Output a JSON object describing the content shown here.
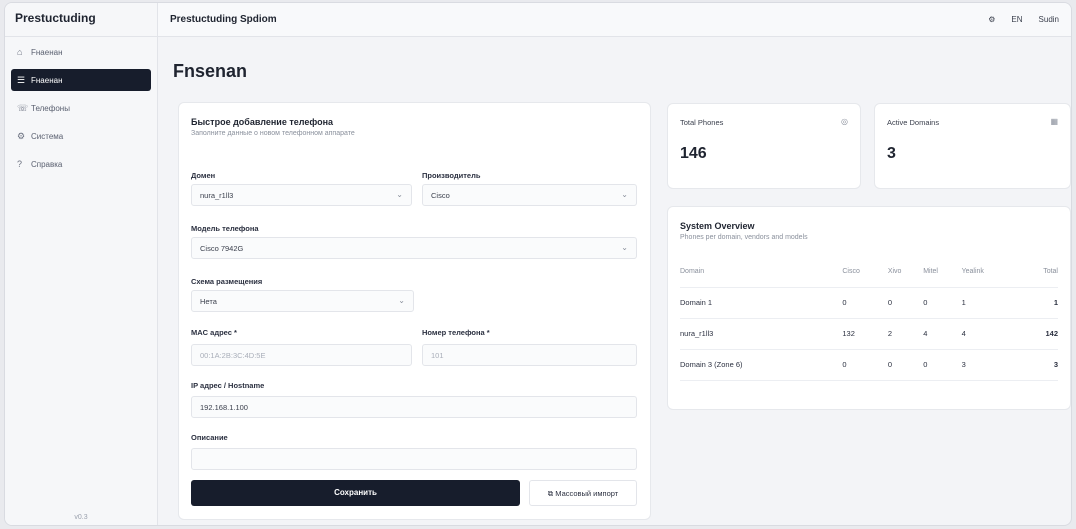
{
  "sidebar": {
    "brand": "Prestuctuding",
    "items": [
      {
        "icon": "home-icon",
        "glyph": "⌂",
        "label": "Fнаенан"
      },
      {
        "icon": "list-icon",
        "glyph": "☰",
        "label": "Fнаенан"
      },
      {
        "icon": "phone-icon",
        "glyph": "☏",
        "label": "Телефоны"
      },
      {
        "icon": "settings-icon",
        "glyph": "⚙",
        "label": "Система"
      },
      {
        "icon": "help-icon",
        "glyph": "?",
        "label": "Справка"
      }
    ],
    "footer": "v0.3"
  },
  "topbar": {
    "title": "Prestuctuding Spdiom",
    "lang": "EN",
    "user": "Sudin"
  },
  "page": {
    "title": "Fnsenan"
  },
  "form": {
    "title": "Быстрое добавление телефона",
    "subtitle": "Заполните данные о новом телефонном аппарате",
    "fields": {
      "domain_label": "Домен",
      "domain_value": "nura_r1ll3",
      "vendor_label": "Производитель",
      "vendor_value": "Cisco",
      "model_label": "Модель телефона",
      "model_value": "Cisco 7942G",
      "schema_label": "Схема размещения",
      "schema_value": "Нета",
      "mac_label": "MAC адрес *",
      "mac_placeholder": "00:1A:2B:3C:4D:5E",
      "number_label": "Номер телефона *",
      "number_placeholder": "101",
      "ip_label": "IP адрес / Hostname",
      "ip_value": "192.168.1.100",
      "desc_label": "Описание",
      "desc_value": ""
    },
    "save_label": "Сохранить",
    "secondary_label": "Массовый импорт"
  },
  "stats": [
    {
      "label": "Total Phones",
      "value": "146",
      "icon": "phone-icon"
    },
    {
      "label": "Active Domains",
      "value": "3",
      "icon": "grid-icon"
    }
  ],
  "systems": {
    "title": "System Overview",
    "subtitle": "Phones per domain, vendors and models",
    "columns": [
      "Domain",
      "Cisco",
      "Xivo",
      "Mitel",
      "Yealink",
      "Total"
    ],
    "rows": [
      {
        "cells": [
          "Domain 1",
          "0",
          "0",
          "0",
          "1",
          "1"
        ]
      },
      {
        "cells": [
          "nura_r1ll3",
          "132",
          "2",
          "4",
          "4",
          "142"
        ]
      },
      {
        "cells": [
          "Domain 3 (Zone 6)",
          "0",
          "0",
          "0",
          "3",
          "3"
        ]
      }
    ]
  }
}
